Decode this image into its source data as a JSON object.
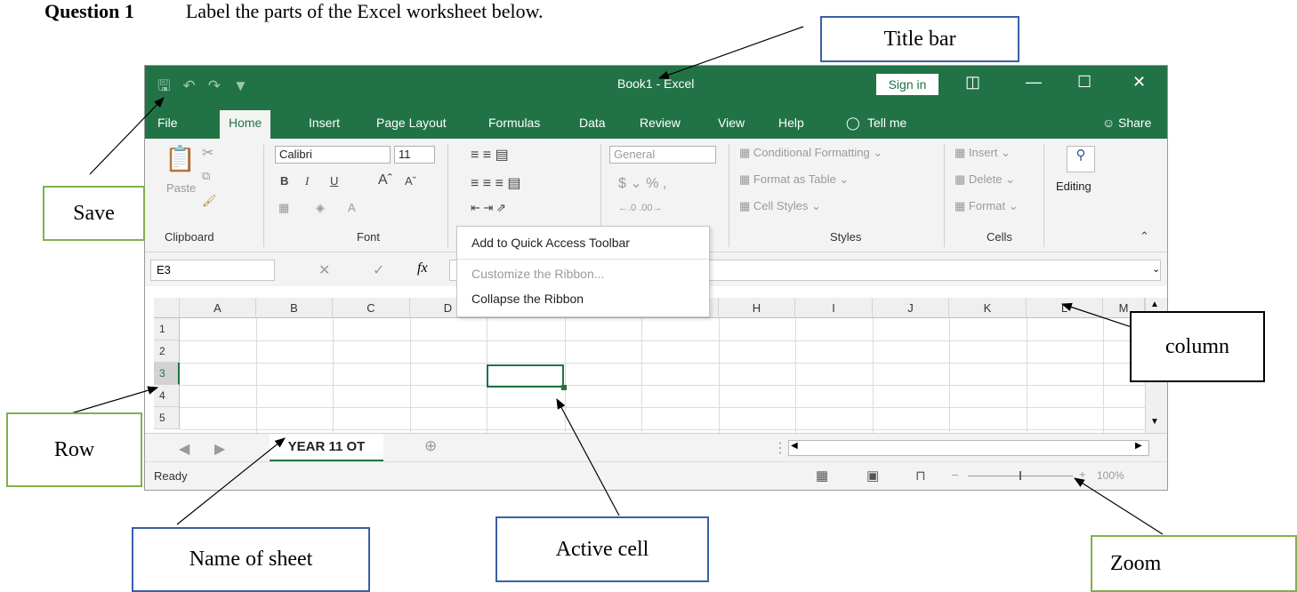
{
  "question": {
    "number": "Question 1",
    "text": "Label the parts of the Excel worksheet below."
  },
  "labels": {
    "title_bar": "Title bar",
    "save": "Save",
    "column": "column",
    "row": "Row",
    "name_of_sheet": "Name of sheet",
    "active_cell": "Active cell",
    "zoom": "Zoom"
  },
  "excel": {
    "title": "Book1 - Excel",
    "sign_in": "Sign in",
    "tabs": [
      "File",
      "Home",
      "Insert",
      "Page Layout",
      "Formulas",
      "Data",
      "Review",
      "View",
      "Help",
      "Tell me"
    ],
    "share": "Share",
    "ribbon": {
      "paste": "Paste",
      "font_name": "Calibri",
      "font_size": "11",
      "number_format": "General",
      "conditional_formatting": "Conditional Formatting",
      "format_as_table": "Format as Table",
      "cell_styles": "Cell Styles",
      "insert": "Insert",
      "delete": "Delete",
      "format": "Format",
      "editing": "Editing",
      "groups": {
        "clipboard": "Clipboard",
        "font": "Font",
        "styles": "Styles",
        "cells": "Cells"
      }
    },
    "name_box": "E3",
    "context_menu": [
      "Add to Quick Access Toolbar",
      "Customize the Ribbon...",
      "Collapse the Ribbon"
    ],
    "columns": [
      "A",
      "B",
      "C",
      "D",
      "H",
      "I",
      "J",
      "K",
      "L",
      "M"
    ],
    "rows": [
      "1",
      "2",
      "3",
      "4",
      "5"
    ],
    "sheet_name": "YEAR 11 OT",
    "status": "Ready",
    "zoom_level": "100%",
    "colors": {
      "excel_green": "#217346",
      "ribbon_bg": "#f3f3f3"
    }
  }
}
